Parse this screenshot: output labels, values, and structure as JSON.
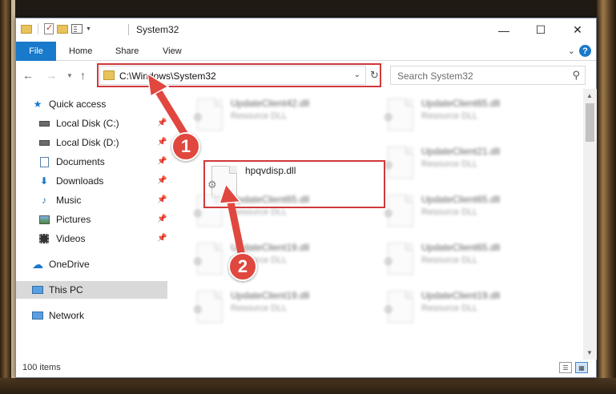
{
  "window": {
    "title": "System32",
    "controls": {
      "minimize": "—",
      "maximize": "☐",
      "close": "✕"
    }
  },
  "ribbon": {
    "tabs": [
      "File",
      "Home",
      "Share",
      "View"
    ],
    "help": "?"
  },
  "address": {
    "path": "C:\\Windows\\System32",
    "search_placeholder": "Search System32"
  },
  "sidebar": {
    "quick_access": "Quick access",
    "items": [
      {
        "label": "Local Disk (C:)",
        "icon": "drive-icon",
        "pinned": true
      },
      {
        "label": "Local Disk (D:)",
        "icon": "drive-icon",
        "pinned": true
      },
      {
        "label": "Documents",
        "icon": "document-icon",
        "pinned": true
      },
      {
        "label": "Downloads",
        "icon": "download-icon",
        "pinned": true
      },
      {
        "label": "Music",
        "icon": "music-icon",
        "pinned": true
      },
      {
        "label": "Pictures",
        "icon": "pictures-icon",
        "pinned": true
      },
      {
        "label": "Videos",
        "icon": "video-icon",
        "pinned": true
      }
    ],
    "onedrive": "OneDrive",
    "this_pc": "This PC",
    "network": "Network"
  },
  "files": [
    {
      "name": "UpdateClient42.dll",
      "type": "Resource DLL"
    },
    {
      "name": "UpdateClient65.dll",
      "type": "Resource DLL"
    },
    {
      "name": "hpqvdisp.dll",
      "type": ""
    },
    {
      "name": "UpdateClient21.dll",
      "type": "Resource DLL"
    },
    {
      "name": "UpdateClient65.dll",
      "type": "Resource DLL"
    },
    {
      "name": "UpdateClient65.dll",
      "type": "Resource DLL"
    },
    {
      "name": "UpdateClient19.dll",
      "type": "Resource DLL"
    },
    {
      "name": "UpdateClient65.dll",
      "type": "Resource DLL"
    },
    {
      "name": "UpdateClient19.dll",
      "type": "Resource DLL"
    },
    {
      "name": "UpdateClient19.dll",
      "type": "Resource DLL"
    }
  ],
  "status": {
    "item_count": "100 items"
  },
  "annotations": {
    "step1": "1",
    "step2": "2",
    "color": "#d0393b"
  }
}
